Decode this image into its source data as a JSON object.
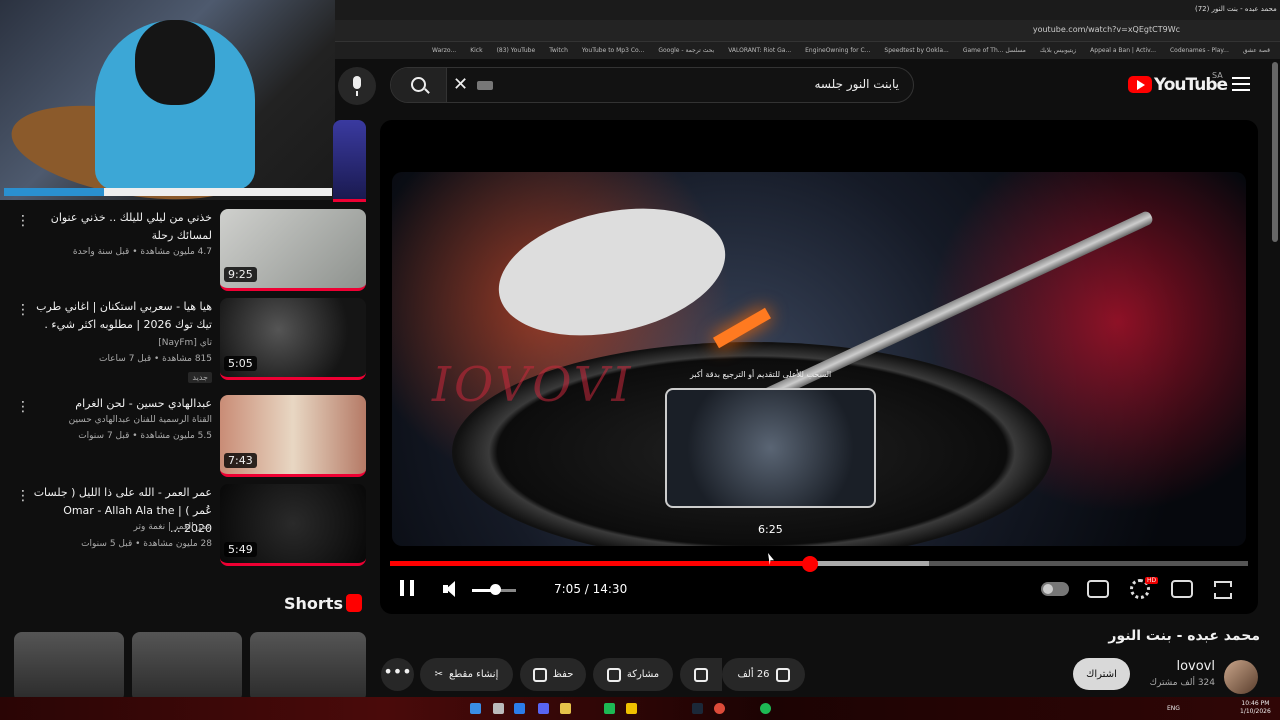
{
  "browser": {
    "tab_title": "(72) محمد عبده - بنت النور",
    "url": "youtube.com/watch?v=xQEgtCT9Wc",
    "bookmarks": [
      "قصة عشق",
      "Codenames - Play...",
      "Appeal a Ban | Activ...",
      "زيتيوبيس بلايك",
      "Game of Th... مسلسل",
      "Speedtest by Ookla...",
      "EngineOwning for C...",
      "VALORANT: Riot Ga...",
      "Google - بحث ترجمة",
      "YouTube to Mp3 Co...",
      "Twitch",
      "(83) YouTube",
      "Kick",
      "Warzo..."
    ]
  },
  "header": {
    "logo_text": "YouTube",
    "country": "SA",
    "search_value": "يابنت النور جلسه"
  },
  "related": [
    {
      "title": "خذني من ليلي لليلك .. خذني عنوان لمسائك رحلة",
      "meta": "4.7 مليون مشاهدة • قبل سنة واحدة",
      "duration": "9:25",
      "channel": ""
    },
    {
      "title": "هيا هيا - سعربي استكنان | اغاني طرب تيك توك 2026 | مطلوبه اكثر شيء .",
      "channel": "تاي [NayFm]",
      "meta": "815 مشاهدة • قبل 7 ساعات",
      "duration": "5:05",
      "badge": "جديد"
    },
    {
      "title": "عبدالهادي حسين - لحن الغرام",
      "channel": "القناة الرسمية للفنان عبدالهادي حسين",
      "meta": "5.5 مليون مشاهدة • قبل 7 سنوات",
      "duration": "7:43"
    },
    {
      "title": "عمر العمر - الله على ذا الليل ( جلسات عُمر Omar - Allah Ala the | ( 2020 ...",
      "channel": "عمر العمر | نغمة وتر",
      "meta": "28 مليون مشاهدة • قبل 5 سنوات",
      "duration": "5:49"
    }
  ],
  "shorts": {
    "title": "Shorts"
  },
  "player": {
    "watermark": "IOVOVI",
    "preview_hint": "السحب للأعلى للتقديم أو الترجيع بدقة أكبر",
    "preview_time": "6:25",
    "time_display": "7:05 / 14:30",
    "progress_played": 0.489,
    "progress_buffered": 0.628,
    "volume": 0.5,
    "hd_badge": "HD"
  },
  "video": {
    "title": "محمد عبده - بنت النور",
    "channel": "lovovl",
    "subscribers": "324 ألف مشترك",
    "subscribe_label": "اشتراك",
    "likes": "26 ألف",
    "share_label": "مشاركة",
    "save_label": "حفظ",
    "clip_label": "إنشاء مقطع"
  },
  "taskbar": {
    "lang": "ENG",
    "time": "10:46 PM",
    "date": "1/10/2026"
  },
  "colors": {
    "accent": "#ff0000",
    "background": "#0f0f0f",
    "pill": "#272727"
  }
}
